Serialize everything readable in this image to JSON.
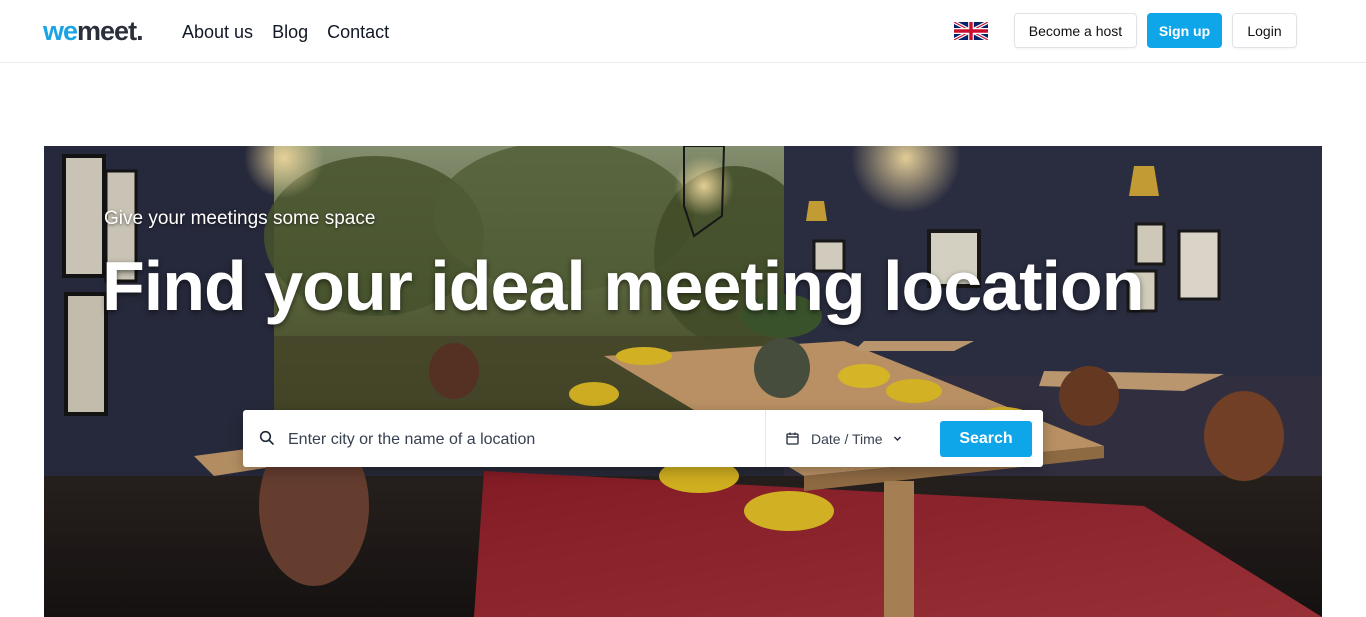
{
  "brand": {
    "logo_part1": "we",
    "logo_part2": "meet",
    "logo_dot": "."
  },
  "nav": {
    "items": [
      "About us",
      "Blog",
      "Contact"
    ]
  },
  "header": {
    "language_flag": "uk-flag-icon",
    "become_host": "Become a host",
    "sign_up": "Sign up",
    "login": "Login"
  },
  "hero": {
    "tagline": "Give your meetings some space",
    "headline": "Find your ideal meeting location",
    "search": {
      "placeholder": "Enter city or the name of a location",
      "datetime_label": "Date / Time",
      "button": "Search"
    }
  },
  "colors": {
    "accent": "#0ea5e9",
    "logo_we": "#1ba3e4",
    "logo_meet": "#2a2f3a"
  },
  "icons": [
    "search-icon",
    "calendar-icon",
    "chevron-down-icon",
    "uk-flag-icon"
  ]
}
